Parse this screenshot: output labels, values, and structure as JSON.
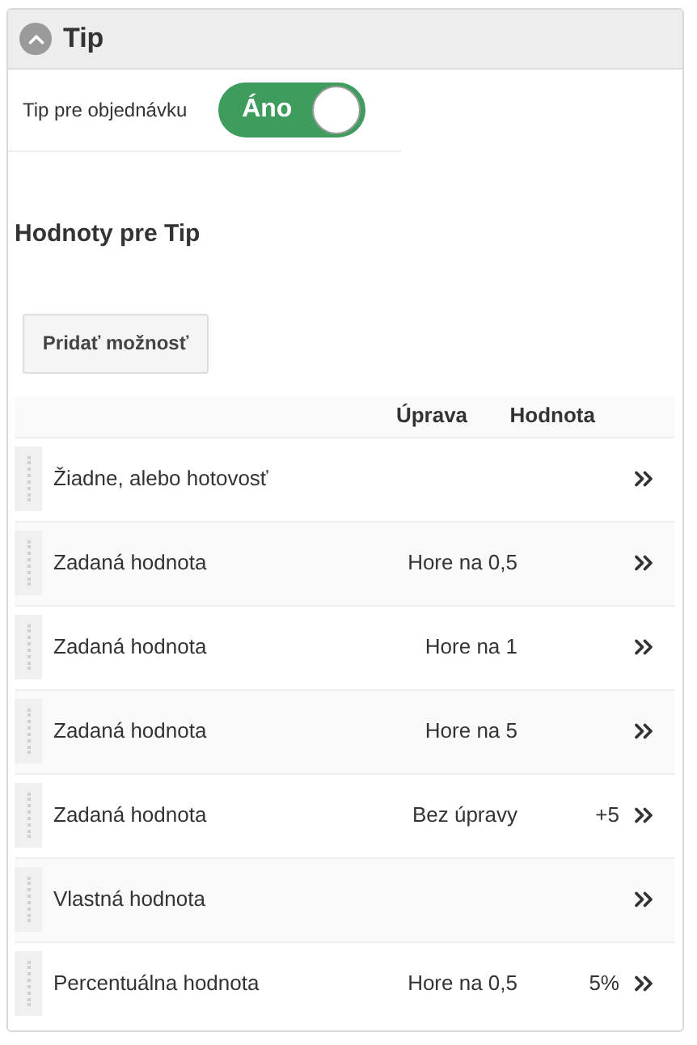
{
  "panel": {
    "title": "Tip",
    "expanded": true
  },
  "toggle": {
    "label": "Tip pre objednávku",
    "on": true,
    "text": "Áno"
  },
  "section_title": "Hodnoty pre Tip",
  "add_button": "Pridať možnosť",
  "table": {
    "columns": [
      "Úprava",
      "Hodnota"
    ],
    "rows": [
      {
        "name": "Žiadne, alebo hotovosť"
      },
      {
        "name": "Zadaná hodnota",
        "adjustment": "Hore na 0,5"
      },
      {
        "name": "Zadaná hodnota",
        "adjustment": "Hore na 1"
      },
      {
        "name": "Zadaná hodnota",
        "adjustment": "Hore na 5"
      },
      {
        "name": "Zadaná hodnota",
        "adjustment": "Bez úpravy",
        "value": "+5"
      },
      {
        "name": "Vlastná hodnota"
      },
      {
        "name": "Percentuálna hodnota",
        "adjustment": "Hore na 0,5",
        "value": "5%"
      }
    ]
  }
}
